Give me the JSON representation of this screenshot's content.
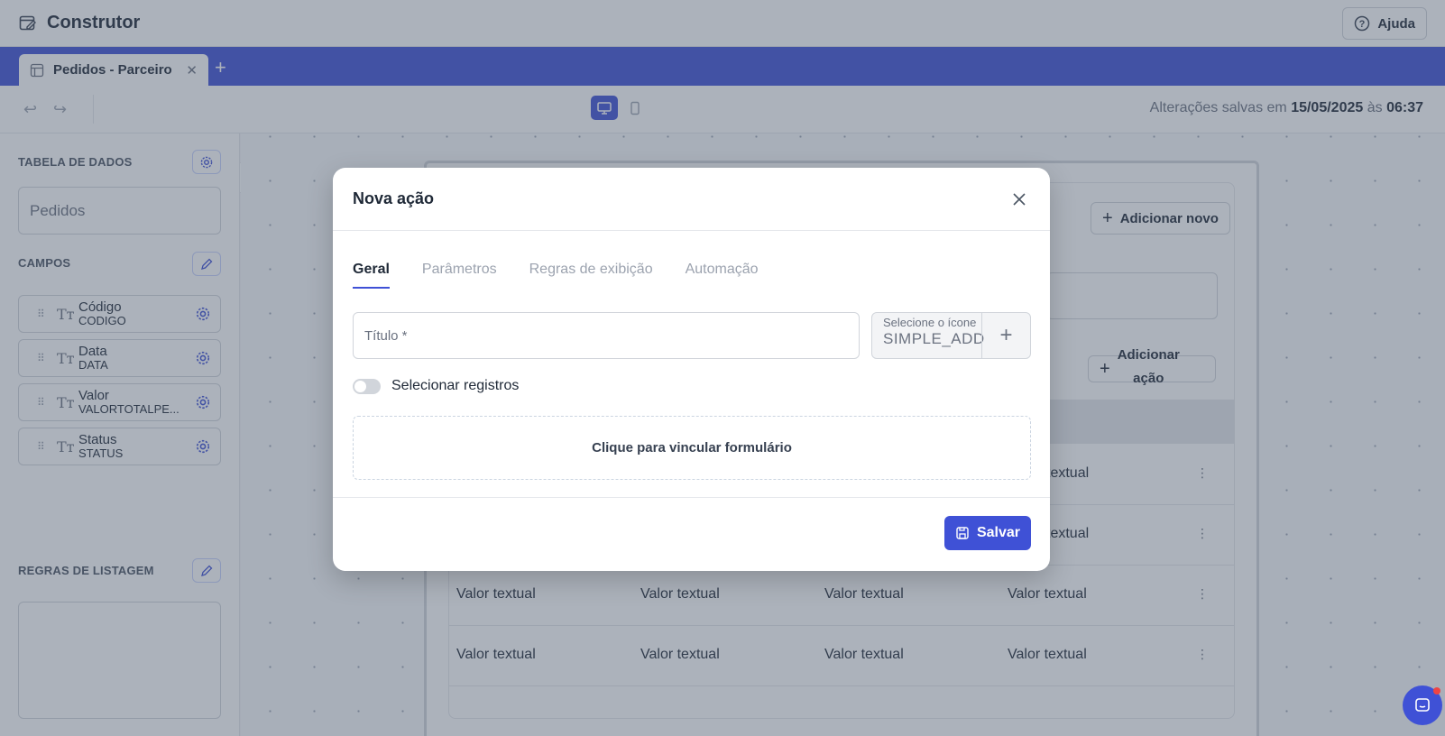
{
  "header": {
    "title": "Construtor",
    "help_label": "Ajuda"
  },
  "tabs": {
    "items": [
      {
        "label": "Pedidos - Parceiro",
        "close": "✕"
      }
    ],
    "add": "+"
  },
  "toolbar": {
    "saved_prefix": "Alterações salvas em",
    "saved_date": "15/05/2025",
    "saved_mid": "às",
    "saved_time": "06:37"
  },
  "sidebar": {
    "data_table_title": "TABELA DE DADOS",
    "data_table_value": "Pedidos",
    "fields_title": "CAMPOS",
    "fields": [
      {
        "label": "Código",
        "code": "CODIGO"
      },
      {
        "label": "Data",
        "code": "DATA"
      },
      {
        "label": "Valor",
        "code": "VALORTOTALPE..."
      },
      {
        "label": "Status",
        "code": "STATUS"
      }
    ],
    "field_type_glyph": "Tт",
    "list_rules_title": "REGRAS DE LISTAGEM"
  },
  "canvas": {
    "add_new_label": "Adicionar novo",
    "add_action_label_1": "Adicionar",
    "add_action_label_2": "ação",
    "rows": [
      [
        "",
        "",
        "",
        "textual"
      ],
      [
        "",
        "",
        "",
        "textual"
      ],
      [
        "Valor textual",
        "Valor textual",
        "Valor textual",
        "Valor textual"
      ],
      [
        "Valor textual",
        "Valor textual",
        "Valor textual",
        "Valor textual"
      ]
    ]
  },
  "modal": {
    "title": "Nova ação",
    "tabs": [
      "Geral",
      "Parâmetros",
      "Regras de exibição",
      "Automação"
    ],
    "active_tab": "Geral",
    "title_placeholder": "Título *",
    "icon_label": "Selecione o ícone",
    "icon_value": "SIMPLE_ADD",
    "icon_add": "+",
    "toggle_label": "Selecionar registros",
    "link_form_label": "Clique para vincular formulário",
    "save_label": "Salvar"
  },
  "colors": {
    "primary": "#3f51d6",
    "overlay": "#475569"
  }
}
